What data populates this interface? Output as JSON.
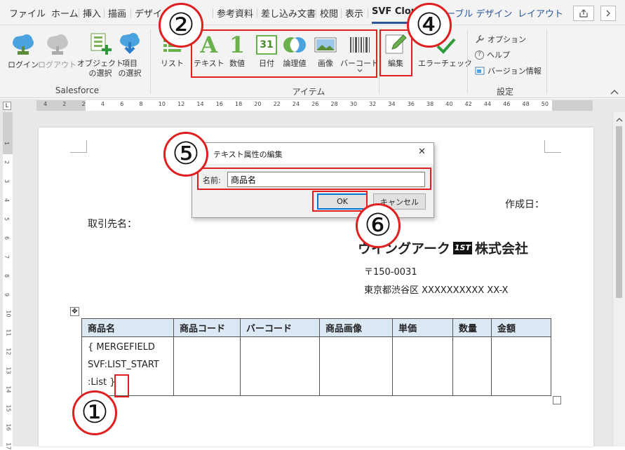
{
  "tabs": [
    {
      "label": "ファイル"
    },
    {
      "label": "ホーム"
    },
    {
      "label": "挿入"
    },
    {
      "label": "描画"
    },
    {
      "label": "デザイン"
    },
    {
      "label": "参考資料"
    },
    {
      "label": "差し込み文書"
    },
    {
      "label": "校閲"
    },
    {
      "label": "表示"
    },
    {
      "label": "SVF Cloud"
    },
    {
      "label": "テーブル デザイン"
    },
    {
      "label": "レイアウト"
    }
  ],
  "ribbon": {
    "salesforce": {
      "group_label": "Salesforce",
      "login": "ログイン",
      "logout": "ログアウト",
      "object_select": [
        "オブジェクト",
        "の選択"
      ],
      "item_select": [
        "項目",
        "の選択"
      ]
    },
    "items": {
      "group_label": "アイテム",
      "list": "リスト",
      "text": "テキスト",
      "number": "数値",
      "date": "日付",
      "logic": "論理値",
      "image": "画像",
      "barcode": "バーコード",
      "date_icon_text": "31",
      "number_icon_text": "1",
      "text_icon_text": "A"
    },
    "edit": {
      "label": "編集"
    },
    "error_check": {
      "label": "エラーチェック"
    },
    "settings": {
      "group_label": "設定",
      "option": "オプション",
      "help": "ヘルプ",
      "version": "バージョン情報"
    }
  },
  "ruler_numbers": [
    "4",
    "2",
    "2",
    "4",
    "6",
    "8",
    "10",
    "12",
    "14",
    "16",
    "18",
    "20",
    "22",
    "24",
    "26",
    "28",
    "30",
    "32",
    "34",
    "36",
    "38",
    "40",
    "42",
    "44",
    "46",
    "48",
    "50"
  ],
  "vruler_numbers": [
    "1",
    "2",
    "3",
    "4",
    "5",
    "6",
    "7",
    "8",
    "9",
    "10",
    "11",
    "12",
    "13",
    "14",
    "15",
    "16",
    "17"
  ],
  "document": {
    "created_date_label": "作成日：",
    "client_label": "取引先名：",
    "company_name": "ウイングアーク",
    "company_logo_text": "1ST",
    "company_suffix": "株式会社",
    "postal": "〒150-0031",
    "address": "東京都渋谷区 XXXXXXXXXX XX-X",
    "table_headers": [
      "商品名",
      "商品コード",
      "バーコード",
      "商品画像",
      "単価",
      "数量",
      "金額"
    ],
    "merge_field_lines": [
      "{ MERGEFIELD",
      "SVF:LIST_START",
      ":List }"
    ]
  },
  "dialog": {
    "title": "テキスト属性の編集",
    "name_label": "名前:",
    "name_value": "商品名",
    "ok": "OK",
    "cancel": "キャンセル",
    "close_symbol": "✕"
  },
  "callouts": [
    "①",
    "②",
    "④",
    "⑤",
    "⑥"
  ]
}
